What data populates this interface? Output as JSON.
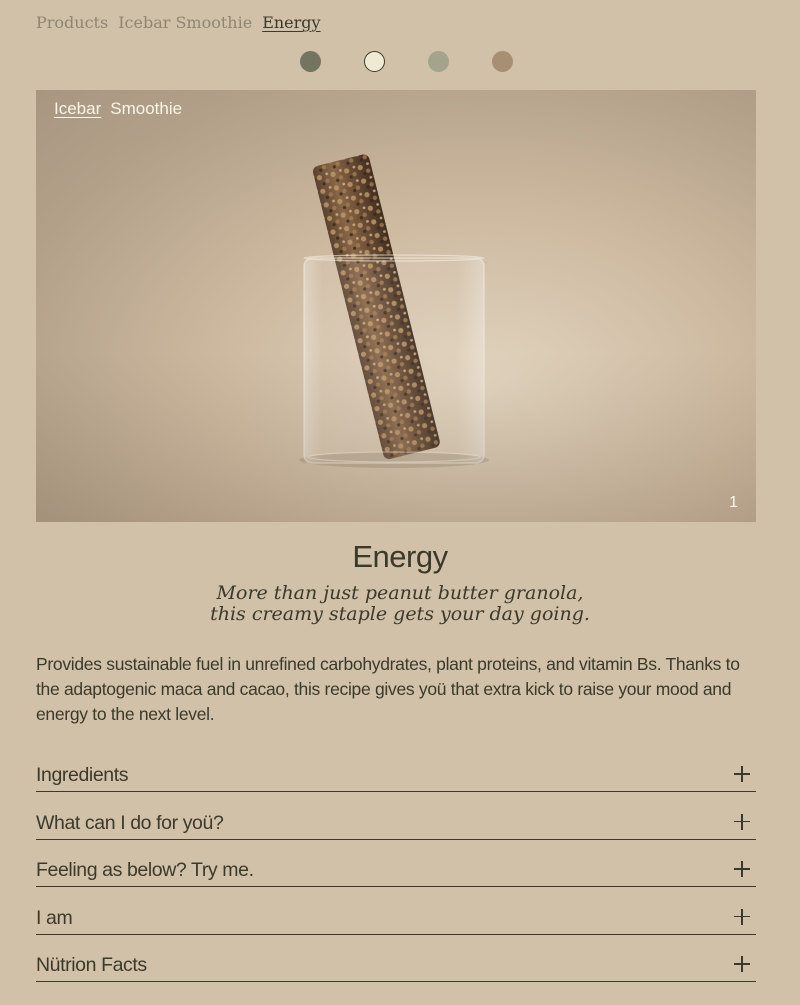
{
  "breadcrumb": [
    {
      "label": "Products"
    },
    {
      "label": "Icebar Smoothie"
    },
    {
      "label": "Energy",
      "current": true
    }
  ],
  "swatches": [
    {
      "name": "swatch-dark-olive",
      "color": "#747462",
      "selected": false
    },
    {
      "name": "swatch-cream",
      "color": "#efead3",
      "selected": true
    },
    {
      "name": "swatch-sage",
      "color": "#a4a38c",
      "selected": false
    },
    {
      "name": "swatch-tan",
      "color": "#a88f73",
      "selected": false
    }
  ],
  "hero": {
    "tabs": [
      {
        "label": "Icebar",
        "active": true
      },
      {
        "label": "Smoothie",
        "active": false
      }
    ],
    "slide_counter": "1",
    "image_icon": "granola-bar-in-glass-photo"
  },
  "product": {
    "title": "Energy",
    "tagline_line1": "More than just peanut butter granola,",
    "tagline_line2": "this creamy staple gets your day going.",
    "description": "Provides sustainable fuel in unrefined carbohydrates, plant proteins, and vitamin Bs. Thanks to the adaptogenic maca and cacao, this recipe gives yoü that extra kick to raise your mood and energy to the next level."
  },
  "accordion": [
    {
      "label": "Ingredients",
      "icon": "plus-icon"
    },
    {
      "label": "What can I do for yoü?",
      "icon": "plus-icon"
    },
    {
      "label": "Feeling as below? Try me.",
      "icon": "plus-icon"
    },
    {
      "label": "I am",
      "icon": "plus-icon"
    },
    {
      "label": "Nütrion Facts",
      "icon": "plus-icon"
    }
  ],
  "colors": {
    "background": "#d1c1a8",
    "text": "#3b3a2a",
    "muted_text": "#8e8672",
    "hero_text": "#fbf5e6"
  }
}
